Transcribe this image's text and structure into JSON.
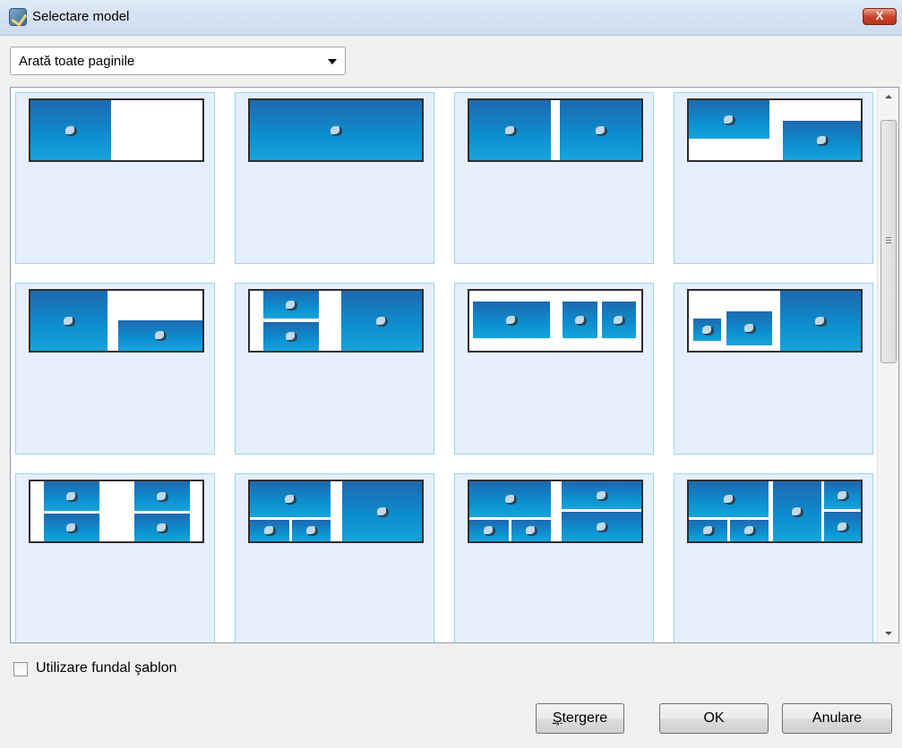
{
  "window": {
    "title": "Selectare model",
    "close_label": "X"
  },
  "filter": {
    "selected": "Arată toate paginile"
  },
  "options": {
    "use_template_background_label": "Utilizare fundal şablon",
    "use_template_background_checked": false
  },
  "buttons": {
    "delete_first": "Ş",
    "delete_rest": "tergere",
    "ok": "OK",
    "cancel": "Anulare"
  },
  "templates": [
    {
      "name": "layout-1"
    },
    {
      "name": "layout-2"
    },
    {
      "name": "layout-3"
    },
    {
      "name": "layout-4"
    },
    {
      "name": "layout-5"
    },
    {
      "name": "layout-6"
    },
    {
      "name": "layout-7"
    },
    {
      "name": "layout-8"
    },
    {
      "name": "layout-9"
    },
    {
      "name": "layout-10"
    },
    {
      "name": "layout-11"
    },
    {
      "name": "layout-12"
    }
  ]
}
